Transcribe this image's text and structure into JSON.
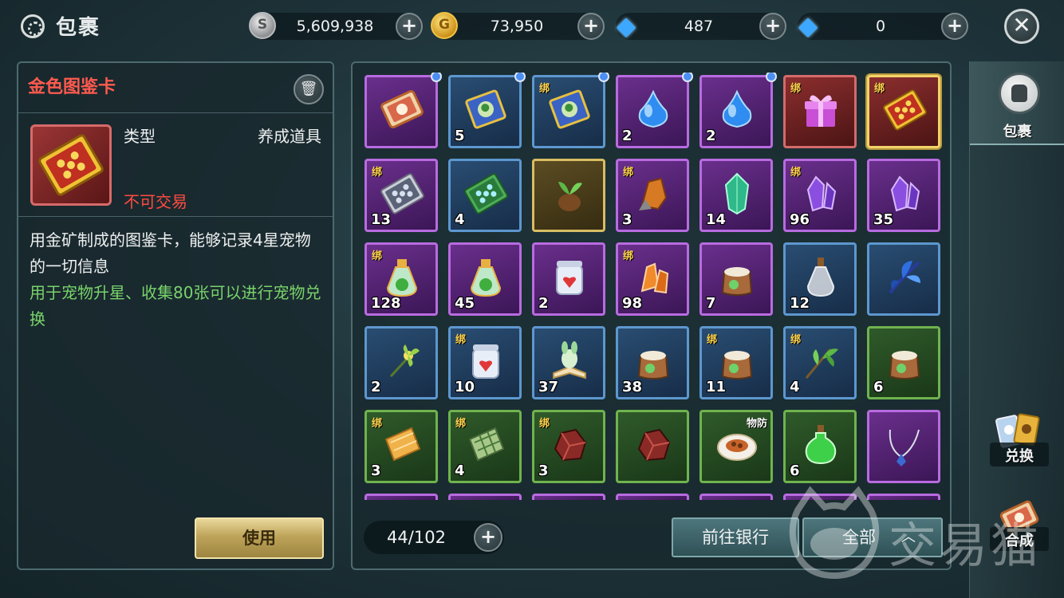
{
  "header": {
    "title": "包裹",
    "currencies": [
      {
        "name": "silver",
        "icon": "silver-coin-icon",
        "value": "5,609,938"
      },
      {
        "name": "gold",
        "icon": "gold-coin-icon",
        "value": "73,950"
      },
      {
        "name": "bound-diamond",
        "icon": "locked-diamond-icon",
        "value": "487"
      },
      {
        "name": "diamond",
        "icon": "diamond-icon",
        "value": "0"
      }
    ],
    "plus": "+",
    "close": "✕"
  },
  "detail": {
    "name": "金色图鉴卡",
    "type_label": "类型",
    "type_value": "养成道具",
    "trade": "不可交易",
    "description": "用金矿制成的图鉴卡，能够记录4星宠物的一切信息",
    "usage": "用于宠物升星、收集80张可以进行宠物兑换",
    "use_button": "使用"
  },
  "inventory": {
    "bind_label": "绑",
    "items": [
      {
        "icon": "treasure-scroll-icon",
        "quality": "purple",
        "count": "",
        "bound": false,
        "new": true,
        "tag": ""
      },
      {
        "icon": "pet-card-icon",
        "quality": "blue",
        "count": "5",
        "bound": false,
        "new": true,
        "tag": ""
      },
      {
        "icon": "pet-card-icon",
        "quality": "blue",
        "count": "",
        "bound": true,
        "new": true,
        "tag": ""
      },
      {
        "icon": "blue-slime-icon",
        "quality": "purple",
        "count": "2",
        "bound": false,
        "new": true,
        "tag": ""
      },
      {
        "icon": "blue-slime-icon",
        "quality": "purple",
        "count": "2",
        "bound": false,
        "new": true,
        "tag": ""
      },
      {
        "icon": "gift-box-icon",
        "quality": "red",
        "count": "",
        "bound": true,
        "new": false,
        "tag": ""
      },
      {
        "icon": "gold-card-icon",
        "quality": "red",
        "count": "",
        "bound": true,
        "new": false,
        "tag": "",
        "selected": true
      },
      {
        "icon": "silver-card-icon",
        "quality": "purple",
        "count": "13",
        "bound": true,
        "new": false,
        "tag": ""
      },
      {
        "icon": "green-card-icon",
        "quality": "blue",
        "count": "4",
        "bound": false,
        "new": false,
        "tag": ""
      },
      {
        "icon": "seed-sprout-icon",
        "quality": "gold",
        "count": "",
        "bound": false,
        "new": false,
        "tag": ""
      },
      {
        "icon": "amber-ore-icon",
        "quality": "purple",
        "count": "3",
        "bound": true,
        "new": false,
        "tag": ""
      },
      {
        "icon": "green-crystal-icon",
        "quality": "purple",
        "count": "14",
        "bound": false,
        "new": false,
        "tag": ""
      },
      {
        "icon": "purple-crystal-icon",
        "quality": "purple",
        "count": "96",
        "bound": true,
        "new": false,
        "tag": ""
      },
      {
        "icon": "purple-crystal-icon",
        "quality": "purple",
        "count": "35",
        "bound": false,
        "new": false,
        "tag": ""
      },
      {
        "icon": "potion-flask-icon",
        "quality": "purple",
        "count": "128",
        "bound": true,
        "new": false,
        "tag": ""
      },
      {
        "icon": "potion-flask-icon",
        "quality": "purple",
        "count": "45",
        "bound": false,
        "new": false,
        "tag": ""
      },
      {
        "icon": "heart-jar-icon",
        "quality": "purple",
        "count": "2",
        "bound": false,
        "new": false,
        "tag": ""
      },
      {
        "icon": "orange-crystal-icon",
        "quality": "purple",
        "count": "98",
        "bound": true,
        "new": false,
        "tag": ""
      },
      {
        "icon": "food-sack-icon",
        "quality": "purple",
        "count": "7",
        "bound": false,
        "new": false,
        "tag": ""
      },
      {
        "icon": "empty-bottle-icon",
        "quality": "blue",
        "count": "12",
        "bound": false,
        "new": false,
        "tag": ""
      },
      {
        "icon": "blue-feather-icon",
        "quality": "blue",
        "count": "",
        "bound": false,
        "new": false,
        "tag": ""
      },
      {
        "icon": "herb-flower-icon",
        "quality": "blue",
        "count": "2",
        "bound": false,
        "new": false,
        "tag": ""
      },
      {
        "icon": "heart-jar-icon",
        "quality": "blue",
        "count": "10",
        "bound": true,
        "new": false,
        "tag": ""
      },
      {
        "icon": "pet-book-icon",
        "quality": "blue",
        "count": "37",
        "bound": false,
        "new": false,
        "tag": ""
      },
      {
        "icon": "food-sack-icon",
        "quality": "blue",
        "count": "38",
        "bound": false,
        "new": false,
        "tag": ""
      },
      {
        "icon": "food-sack-icon",
        "quality": "blue",
        "count": "11",
        "bound": true,
        "new": false,
        "tag": ""
      },
      {
        "icon": "herb-branch-icon",
        "quality": "blue",
        "count": "4",
        "bound": true,
        "new": false,
        "tag": ""
      },
      {
        "icon": "food-sack-icon",
        "quality": "green",
        "count": "6",
        "bound": false,
        "new": false,
        "tag": ""
      },
      {
        "icon": "orange-cloth-icon",
        "quality": "green",
        "count": "3",
        "bound": true,
        "new": false,
        "tag": ""
      },
      {
        "icon": "green-cloth-icon",
        "quality": "green",
        "count": "4",
        "bound": true,
        "new": false,
        "tag": ""
      },
      {
        "icon": "red-ore-icon",
        "quality": "green",
        "count": "3",
        "bound": true,
        "new": false,
        "tag": ""
      },
      {
        "icon": "red-ore-icon",
        "quality": "green",
        "count": "",
        "bound": false,
        "new": false,
        "tag": ""
      },
      {
        "icon": "meal-plate-icon",
        "quality": "green",
        "count": "",
        "bound": false,
        "new": false,
        "tag": "物防"
      },
      {
        "icon": "green-potion-icon",
        "quality": "green",
        "count": "6",
        "bound": false,
        "new": false,
        "tag": ""
      },
      {
        "icon": "necklace-icon",
        "quality": "purple",
        "count": "",
        "bound": false,
        "new": false,
        "tag": ""
      }
    ],
    "next_row_qualities": [
      "purple",
      "purple",
      "purple",
      "purple",
      "purple",
      "purple",
      "purple"
    ],
    "capacity": "44/102",
    "bank_button": "前往银行",
    "filter_button": "全部",
    "filter_chevron": "︿"
  },
  "side_tabs": {
    "bag": "包裹",
    "exchange": "兑换",
    "compose": "合成"
  },
  "watermark": "交易猫",
  "colors": {
    "item_name": "#ff5a4e",
    "untradable": "#ff4b40",
    "usage_text": "#79d36a",
    "bind_badge": "#ffd34c",
    "new_dot": "#4c8ef2"
  }
}
